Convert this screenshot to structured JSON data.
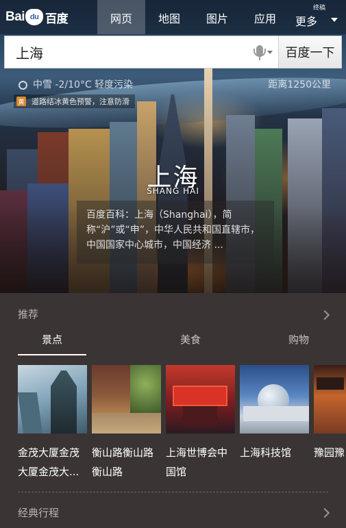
{
  "nav": {
    "logo_latin": "Bai",
    "logo_paw": "du",
    "logo_cn": "百度",
    "tabs": [
      "网页",
      "地图",
      "图片",
      "应用"
    ],
    "more_label": "更多",
    "terminal_label": "终稿"
  },
  "search": {
    "value": "上海",
    "button": "百度一下"
  },
  "weather": {
    "text": "中雪 -2/10°C 轻度污染",
    "distance": "距离1250公里"
  },
  "alert": {
    "badge": "黄",
    "text": "道路结冰黄色预警，注意防滑"
  },
  "city": {
    "name_cn": "上海",
    "name_en": "SHANG HAI",
    "baike": "百度百科：上海（Shanghai），简称“沪”或“申”，中华人民共和国直辖市，中国国家中心城市，中国经济 ..."
  },
  "recommend": {
    "title": "推荐",
    "tabs": [
      "景点",
      "美食",
      "购物"
    ],
    "cards": [
      {
        "line1": "金茂大厦金茂",
        "line2": "大厦金茂大..."
      },
      {
        "line1": "衡山路衡山路",
        "line2": "衡山路"
      },
      {
        "line1": "上海世博会中",
        "line2": "国馆"
      },
      {
        "line1": "上海科技馆",
        "line2": ""
      },
      {
        "line1": "豫园豫",
        "line2": ""
      }
    ]
  },
  "classic": {
    "title": "经典行程"
  }
}
